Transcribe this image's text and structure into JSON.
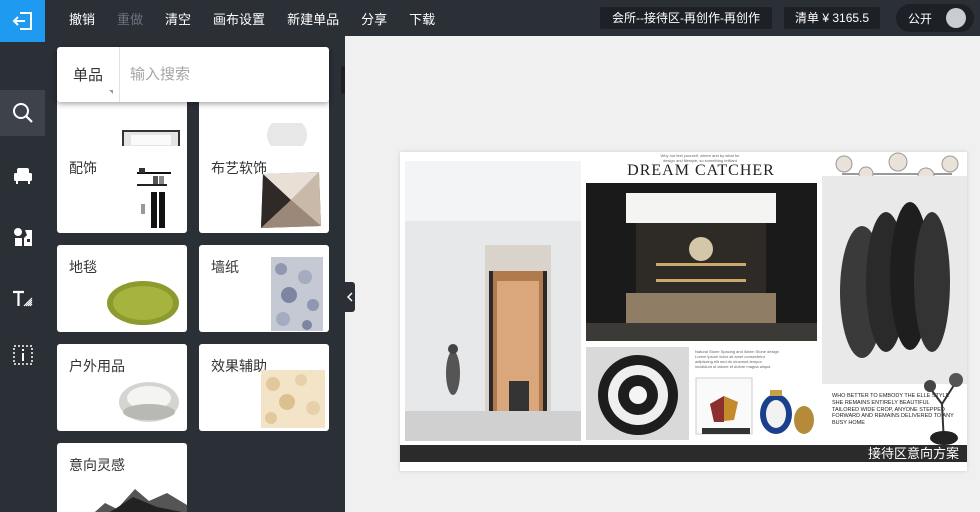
{
  "topbar": {
    "menu": [
      {
        "label": "撤销",
        "enabled": true
      },
      {
        "label": "重做",
        "enabled": false
      },
      {
        "label": "清空",
        "enabled": true
      },
      {
        "label": "画布设置",
        "enabled": true
      },
      {
        "label": "新建单品",
        "enabled": true
      },
      {
        "label": "分享",
        "enabled": true
      },
      {
        "label": "下载",
        "enabled": true
      }
    ],
    "project_title": "会所--接待区-再创作-再创作",
    "price_label": "清单 ¥ 3165.5",
    "public_label": "公开",
    "public_on": false
  },
  "iconbar": {
    "items": [
      {
        "icon": "search-icon",
        "active": true
      },
      {
        "icon": "sofa-icon",
        "active": false
      },
      {
        "icon": "material-icon",
        "active": false
      },
      {
        "icon": "text-style-icon",
        "active": false
      },
      {
        "icon": "info-icon",
        "active": false
      }
    ]
  },
  "panel": {
    "search": {
      "type_label": "单品",
      "placeholder": "输入搜索"
    },
    "categories": [
      {
        "label": ""
      },
      {
        "label": ""
      },
      {
        "label": "配饰"
      },
      {
        "label": "布艺软饰"
      },
      {
        "label": "地毯"
      },
      {
        "label": "墙纸"
      },
      {
        "label": "户外用品"
      },
      {
        "label": "效果辅助"
      },
      {
        "label": "意向灵感"
      }
    ]
  },
  "board": {
    "title": "DREAM CATCHER",
    "footer": "接待区意向方案",
    "quote": "WHO BETTER TO EMBODY THE ELLE STYLE SHE REMAINS ENTIRELY BEAUTIFUL TAILORED WIDE CROP, ANYONE STEPPED FORWARD AND REMAINS DELIVERED TO ANY BUSY HOME"
  },
  "colors": {
    "accent": "#1e9bf0",
    "dark": "#2b2f36",
    "darker": "#1d2026"
  }
}
